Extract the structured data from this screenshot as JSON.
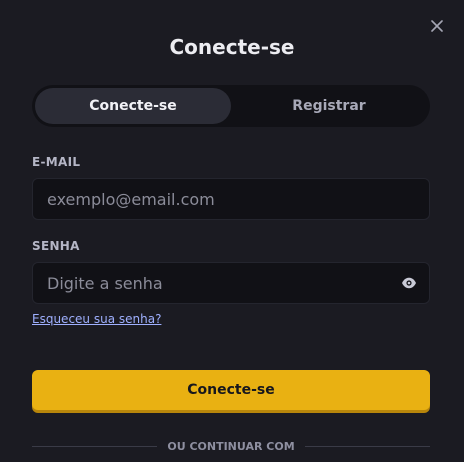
{
  "modal": {
    "title": "Conecte-se",
    "close_icon": "close-icon"
  },
  "tabs": [
    {
      "label": "Conecte-se",
      "active": true
    },
    {
      "label": "Registrar",
      "active": false
    }
  ],
  "email": {
    "label": "E-MAIL",
    "placeholder": "exemplo@email.com",
    "value": ""
  },
  "password": {
    "label": "SENHA",
    "placeholder": "Digite a senha",
    "value": "",
    "toggle_icon": "eye-icon"
  },
  "forgot_link": "Esqueceu sua senha?",
  "submit_label": "Conecte-se",
  "divider_text": "OU CONTINUAR COM",
  "colors": {
    "background": "#1b1b22",
    "input_background": "#111116",
    "accent": "#e9b112",
    "link": "#9fb0ff"
  }
}
